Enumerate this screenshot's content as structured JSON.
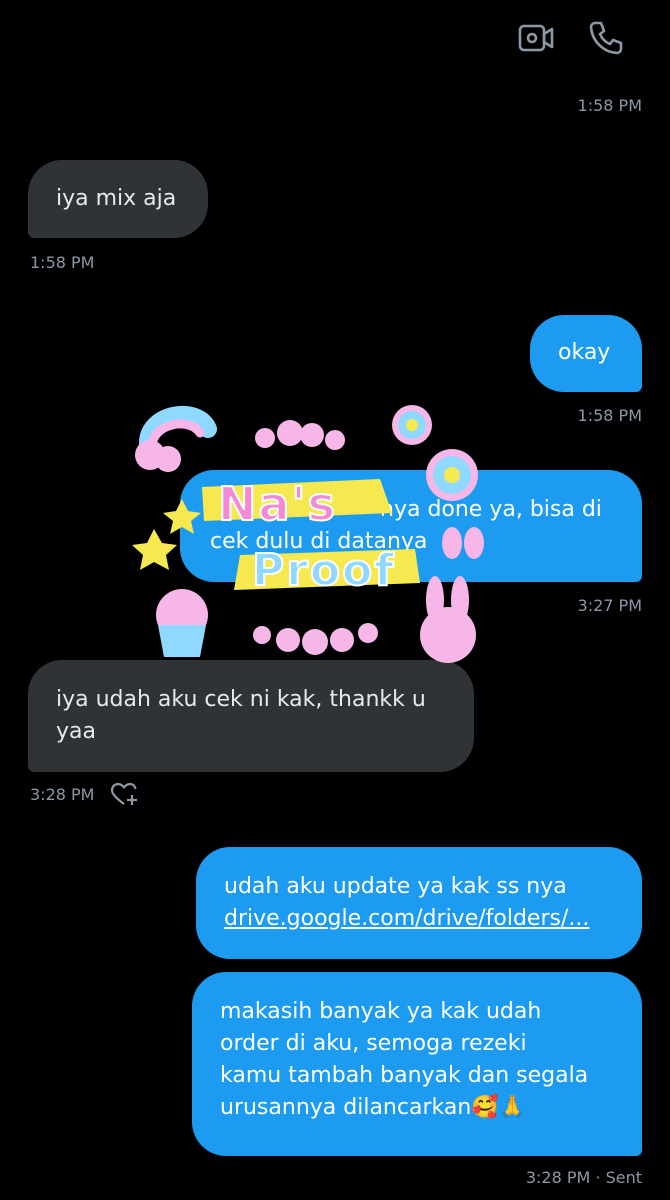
{
  "header": {
    "video_icon": "video-camera-icon",
    "call_icon": "phone-icon"
  },
  "messages": [
    {
      "id": "m0_time",
      "text": "1:58 PM"
    },
    {
      "id": "m1",
      "text": "iya mix aja",
      "time": "1:58 PM"
    },
    {
      "id": "m2",
      "text": "okay",
      "time": "1:58 PM"
    },
    {
      "id": "m3",
      "lines": [
        "nya done ya, bisa di",
        "cek dulu di datanya"
      ],
      "time": "3:27 PM"
    },
    {
      "id": "m4",
      "lines": [
        "iya udah aku cek ni kak, thankk u",
        "yaa"
      ],
      "time": "3:28 PM",
      "reaction_icon": "heart-plus-icon"
    },
    {
      "id": "m5",
      "lines": [
        "udah aku update ya kak ss nya",
        "drive.google.com/drive/folders/..."
      ]
    },
    {
      "id": "m6",
      "lines": [
        "makasih banyak ya kak udah",
        "order di aku, semoga rezeki",
        "kamu tambah banyak dan segala",
        "urusannya dilancarkan🥰🙏"
      ],
      "time": "3:28 PM · Sent"
    }
  ],
  "watermark": {
    "line1": "Na's",
    "line2": "Proof"
  },
  "colors": {
    "incoming": "#2f3336",
    "outgoing": "#1d9bf0",
    "timestamp": "#8b98a5",
    "background": "#000000"
  }
}
